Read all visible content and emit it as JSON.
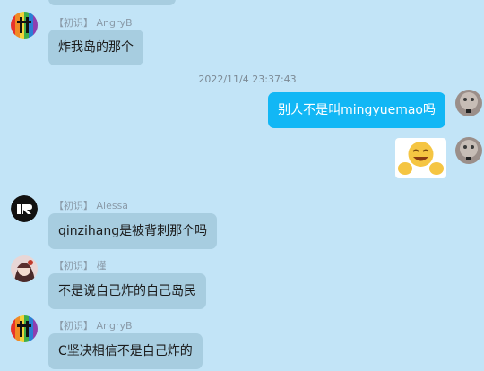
{
  "messages": [
    {
      "tag": "【初识】",
      "sender": "AngryB",
      "text": "炸我岛的那个"
    },
    {
      "timestamp": "2022/11/4 23:37:43"
    },
    {
      "self": true,
      "text": "别人不是叫mingyuemao吗"
    },
    {
      "self": true,
      "sticker": "laughing-emoji-sticker"
    },
    {
      "tag": "【初识】",
      "sender": "Alessa",
      "text": "qinzihang是被背刺那个吗"
    },
    {
      "tag": "【初识】",
      "sender": "槿",
      "text": "不是说自己炸的自己岛民"
    },
    {
      "tag": "【初识】",
      "sender": "AngryB",
      "text": "C坚决相信不是自己炸的"
    }
  ],
  "colors": {
    "background": "#c2e4f7",
    "incoming_bubble": "#a7cde0",
    "outgoing_bubble": "#12b7f5",
    "meta_text": "#8a9aa8"
  }
}
